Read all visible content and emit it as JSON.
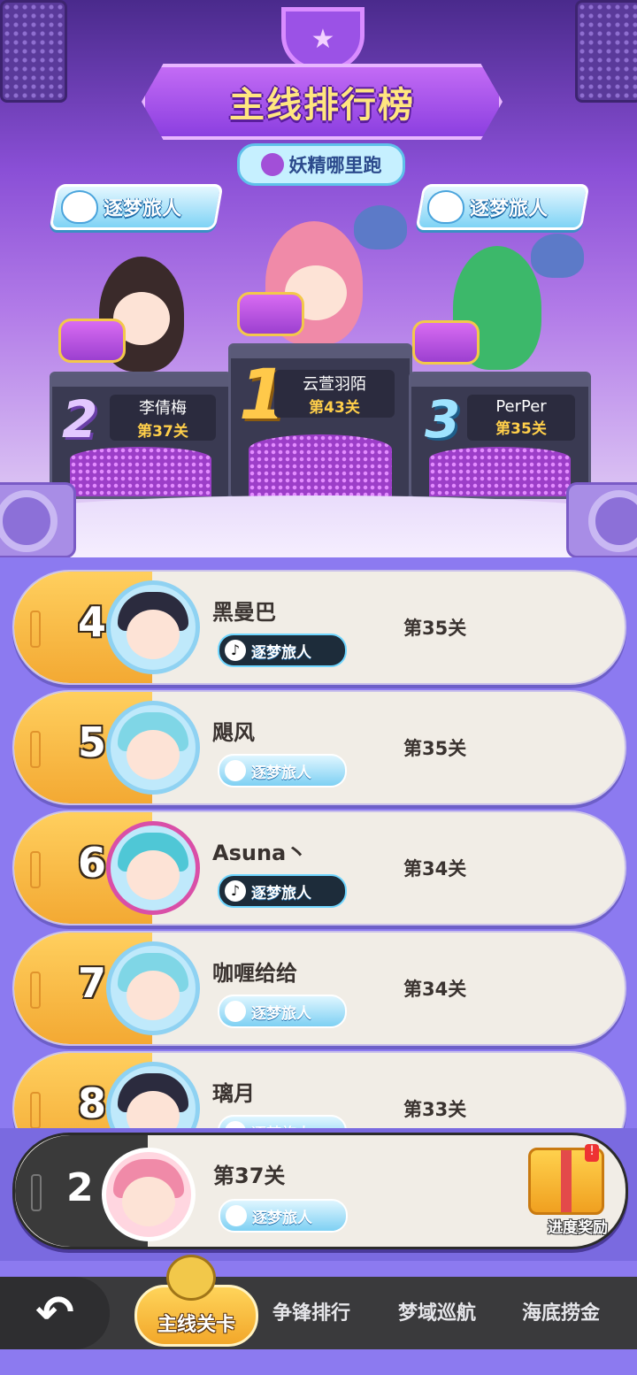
{
  "title": "主线排行榜",
  "game_tag": "妖精哪里跑",
  "top3": [
    {
      "rank": "2",
      "name": "李倩梅",
      "level": "第37关",
      "title": "逐梦旅人"
    },
    {
      "rank": "1",
      "name": "云萱羽陌",
      "level": "第43关",
      "title": ""
    },
    {
      "rank": "3",
      "name": "PerPer",
      "level": "第35关",
      "title": "逐梦旅人"
    }
  ],
  "rows": [
    {
      "rank": "4",
      "name": "黑曼巴",
      "level": "第35关",
      "title": "逐梦旅人",
      "badge_icon": "douyin-icon"
    },
    {
      "rank": "5",
      "name": "飓风",
      "level": "第35关",
      "title": "逐梦旅人",
      "badge_icon": "dream-blob-icon"
    },
    {
      "rank": "6",
      "name": "Asuna丶",
      "level": "第34关",
      "title": "逐梦旅人",
      "badge_icon": "douyin-icon"
    },
    {
      "rank": "7",
      "name": "咖喱给给",
      "level": "第34关",
      "title": "逐梦旅人",
      "badge_icon": "dream-blob-icon"
    },
    {
      "rank": "8",
      "name": "璃月",
      "level": "第33关",
      "title": "逐梦旅人",
      "badge_icon": "dream-blob-icon"
    }
  ],
  "me": {
    "rank": "2",
    "level": "第37关",
    "title": "逐梦旅人",
    "reward_label": "进度奖励",
    "reward_alert": "!"
  },
  "nav": {
    "back_icon": "↶",
    "tabs": [
      "主线关卡",
      "争锋排行",
      "梦域巡航",
      "海底捞金"
    ],
    "active_tab": "主线关卡"
  },
  "colors": {
    "accent": "#f3a933",
    "stage": "#8a4fd6",
    "list_bg": "#8c7af0"
  }
}
